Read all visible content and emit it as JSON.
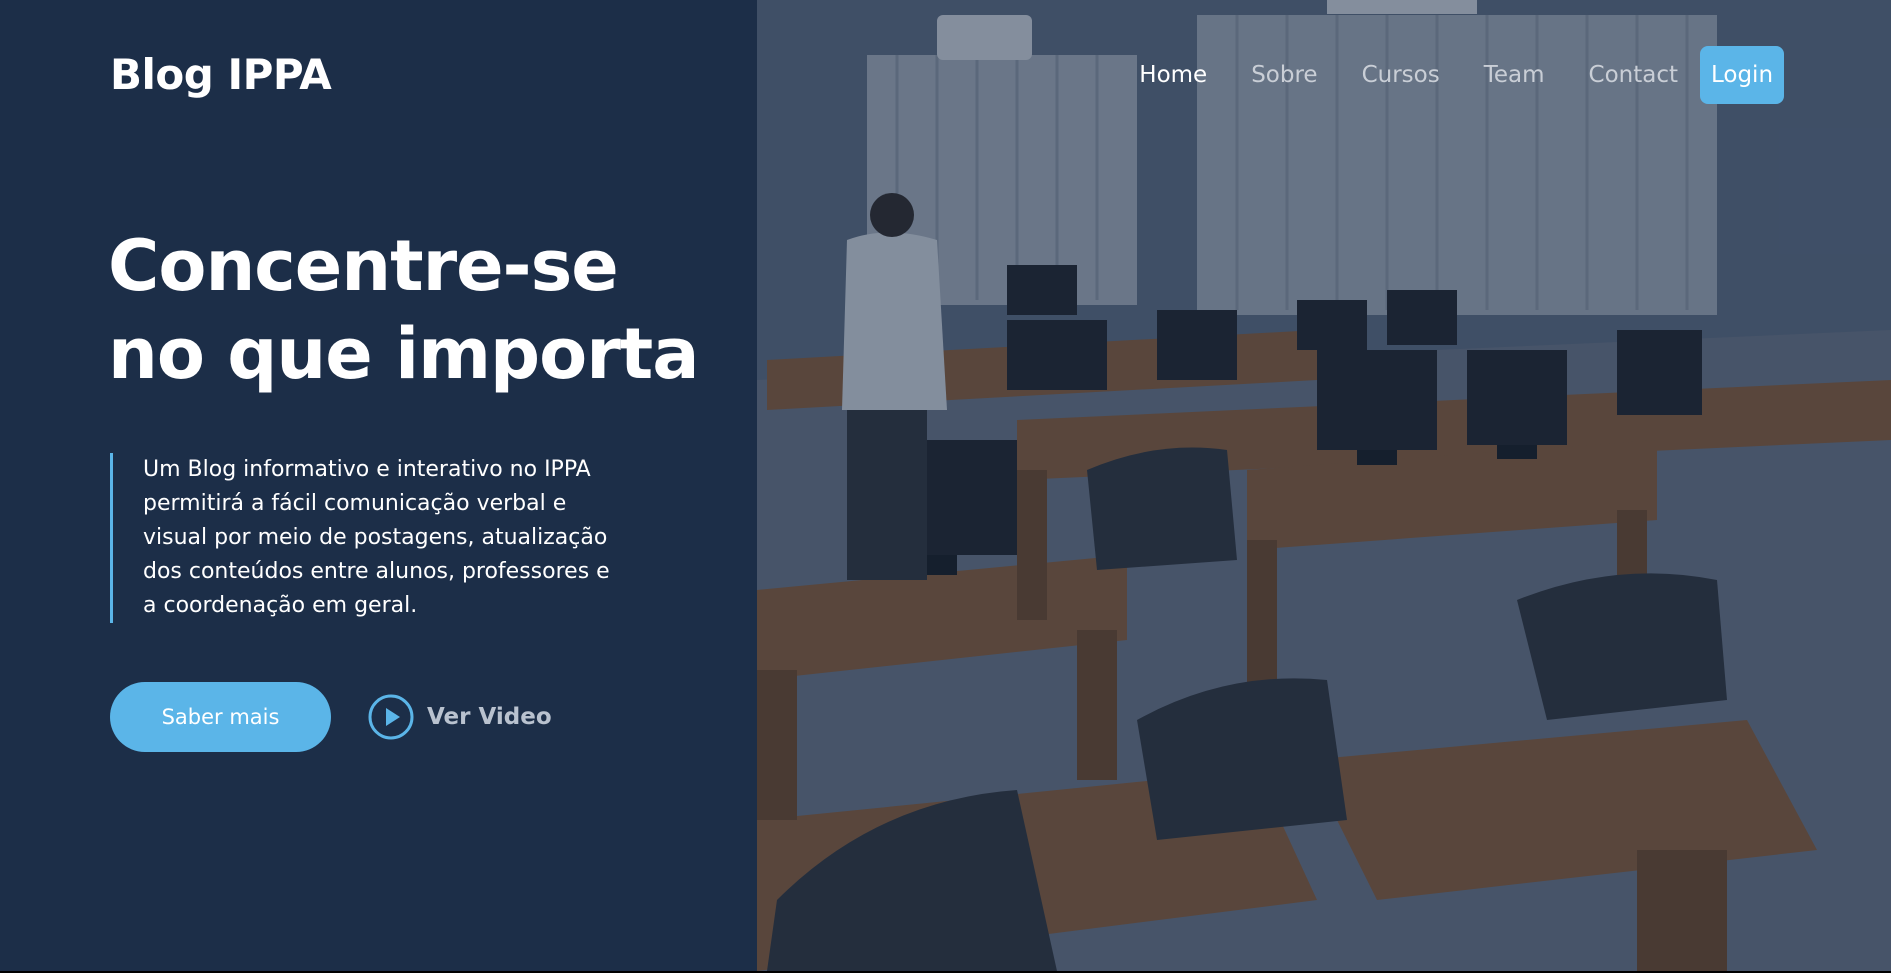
{
  "brand": {
    "title": "Blog IPPA"
  },
  "nav": {
    "items": [
      {
        "label": "Home",
        "active": true
      },
      {
        "label": "Sobre",
        "active": false
      },
      {
        "label": "Cursos",
        "active": false
      },
      {
        "label": "Team",
        "active": false
      },
      {
        "label": "Contact",
        "active": false
      }
    ],
    "login_label": "Login"
  },
  "hero": {
    "headline_line1": "Concentre-se",
    "headline_line2": "no que importa",
    "description": "Um Blog informativo e interativo no IPPA permitirá a fácil comunicação verbal e visual por meio de postagens, atualização dos conteúdos entre alunos, professores e a coordenação em geral.",
    "primary_button": "Saber mais",
    "video_link": "Ver Video",
    "video_icon": "play-circle-icon"
  },
  "colors": {
    "panel_bg": "#1c2e48",
    "accent": "#5bb5e8",
    "text_light": "#ffffff",
    "text_muted": "#b9c2cf"
  },
  "image": {
    "subject": "computer-lab-classroom-photo"
  }
}
